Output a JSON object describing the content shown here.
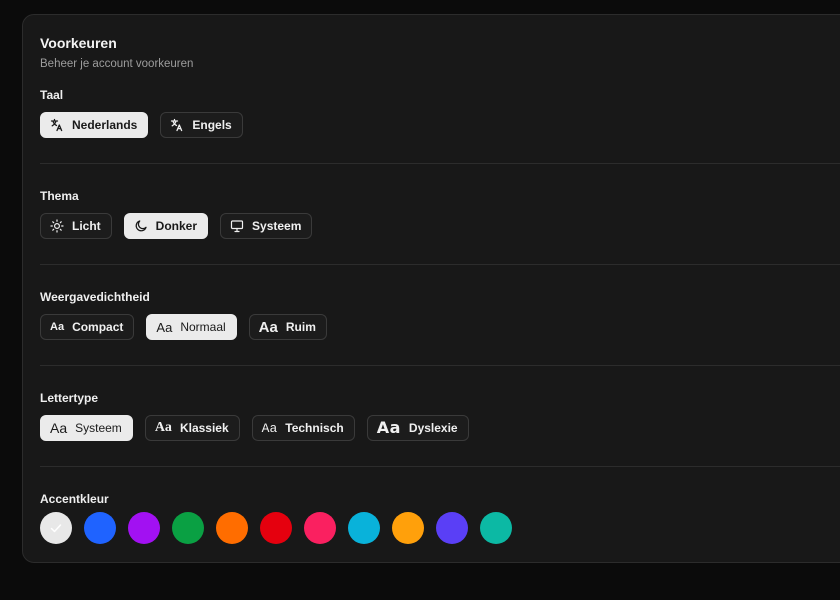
{
  "header": {
    "title": "Voorkeuren",
    "subtitle": "Beheer je account voorkeuren"
  },
  "language": {
    "label": "Taal",
    "options": [
      {
        "label": "Nederlands",
        "icon": "translate-icon",
        "selected": true
      },
      {
        "label": "Engels",
        "icon": "translate-icon",
        "selected": false
      }
    ]
  },
  "theme": {
    "label": "Thema",
    "options": [
      {
        "label": "Licht",
        "icon": "sun-icon",
        "selected": false
      },
      {
        "label": "Donker",
        "icon": "moon-icon",
        "selected": true
      },
      {
        "label": "Systeem",
        "icon": "monitor-icon",
        "selected": false
      }
    ]
  },
  "density": {
    "label": "Weergavedichtheid",
    "options": [
      {
        "label": "Compact",
        "glyph": "Aa",
        "selected": false
      },
      {
        "label": "Normaal",
        "glyph": "Aa",
        "selected": true
      },
      {
        "label": "Ruim",
        "glyph": "Aa",
        "selected": false
      }
    ]
  },
  "font": {
    "label": "Lettertype",
    "options": [
      {
        "label": "Systeem",
        "glyph": "Aa",
        "selected": true
      },
      {
        "label": "Klassiek",
        "glyph": "Aa",
        "selected": false
      },
      {
        "label": "Technisch",
        "glyph": "Aa",
        "selected": false
      },
      {
        "label": "Dyslexie",
        "glyph": "Aa",
        "selected": false
      }
    ]
  },
  "accent": {
    "label": "Accentkleur",
    "colors": [
      {
        "hex": "#e8e8e8",
        "selected": true
      },
      {
        "hex": "#1f63ff",
        "selected": false
      },
      {
        "hex": "#a211f2",
        "selected": false
      },
      {
        "hex": "#0aa043",
        "selected": false
      },
      {
        "hex": "#ff6d00",
        "selected": false
      },
      {
        "hex": "#e5000e",
        "selected": false
      },
      {
        "hex": "#fa2060",
        "selected": false
      },
      {
        "hex": "#09b2da",
        "selected": false
      },
      {
        "hex": "#ffa00b",
        "selected": false
      },
      {
        "hex": "#5a3ff6",
        "selected": false
      },
      {
        "hex": "#0cb9a4",
        "selected": false
      }
    ]
  }
}
